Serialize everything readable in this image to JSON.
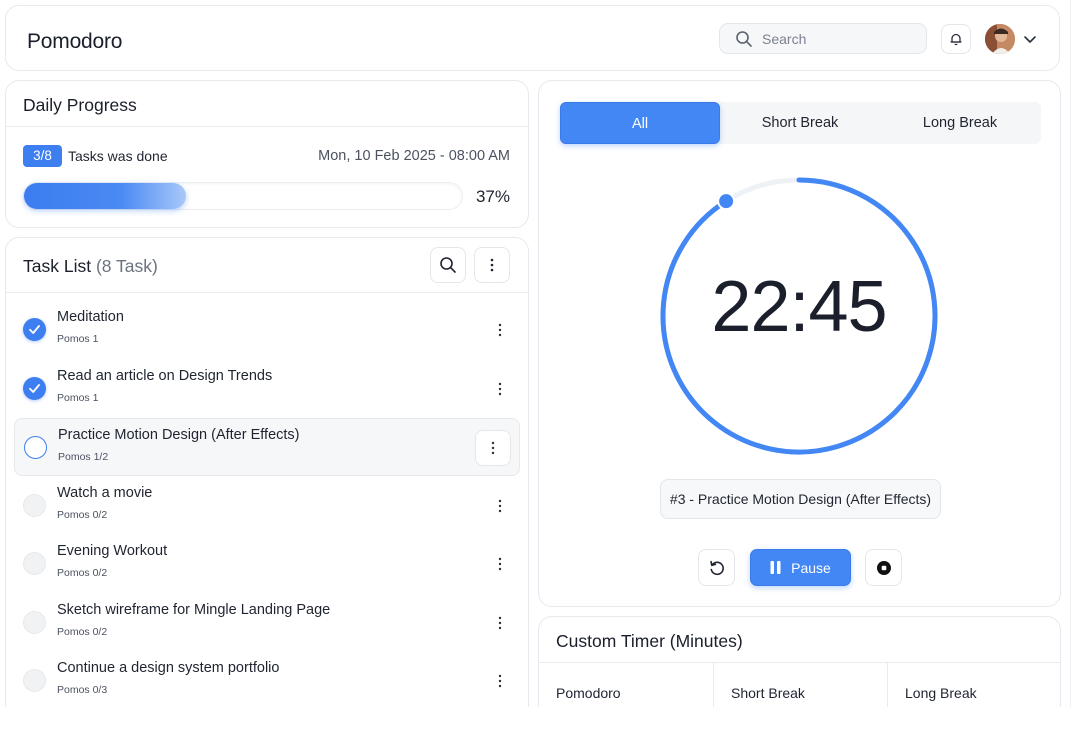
{
  "header": {
    "title": "Pomodoro",
    "search_placeholder": "Search",
    "icons": [
      "search-icon",
      "bell-icon",
      "avatar",
      "chevron-down-icon"
    ]
  },
  "daily_progress": {
    "title": "Daily Progress",
    "badge": "3/8",
    "label": "Tasks was done",
    "date": "Mon, 10 Feb 2025 - 08:00 AM",
    "percent_label": "37%",
    "percent_value": 37
  },
  "task_list": {
    "title": "Task List",
    "count_label": "(8 Task)",
    "tasks": [
      {
        "name": "Meditation",
        "pomos": "Pomos 1",
        "status": "done"
      },
      {
        "name": "Read an article on Design Trends",
        "pomos": "Pomos 1",
        "status": "done"
      },
      {
        "name": "Practice Motion Design (After Effects)",
        "pomos": "Pomos 1/2",
        "status": "current"
      },
      {
        "name": "Watch a movie",
        "pomos": "Pomos 0/2",
        "status": "todo"
      },
      {
        "name": "Evening Workout",
        "pomos": "Pomos 0/2",
        "status": "todo"
      },
      {
        "name": "Sketch wireframe for Mingle Landing Page",
        "pomos": "Pomos 0/2",
        "status": "todo"
      },
      {
        "name": "Continue a design system portfolio",
        "pomos": "Pomos 0/3",
        "status": "todo"
      }
    ]
  },
  "timer": {
    "tabs": [
      "All",
      "Short Break",
      "Long Break"
    ],
    "selected_tab": 0,
    "time": "22:45",
    "ring_progress_fraction": 0.91,
    "current_task": "#3 - Practice Motion Design (After Effects)",
    "pause_label": "Pause"
  },
  "custom_timer": {
    "title": "Custom Timer (Minutes)",
    "columns": [
      "Pomodoro",
      "Short Break",
      "Long Break"
    ]
  },
  "colors": {
    "accent": "#4287f4",
    "text": "#1f2430",
    "border": "#e7e9ee"
  }
}
